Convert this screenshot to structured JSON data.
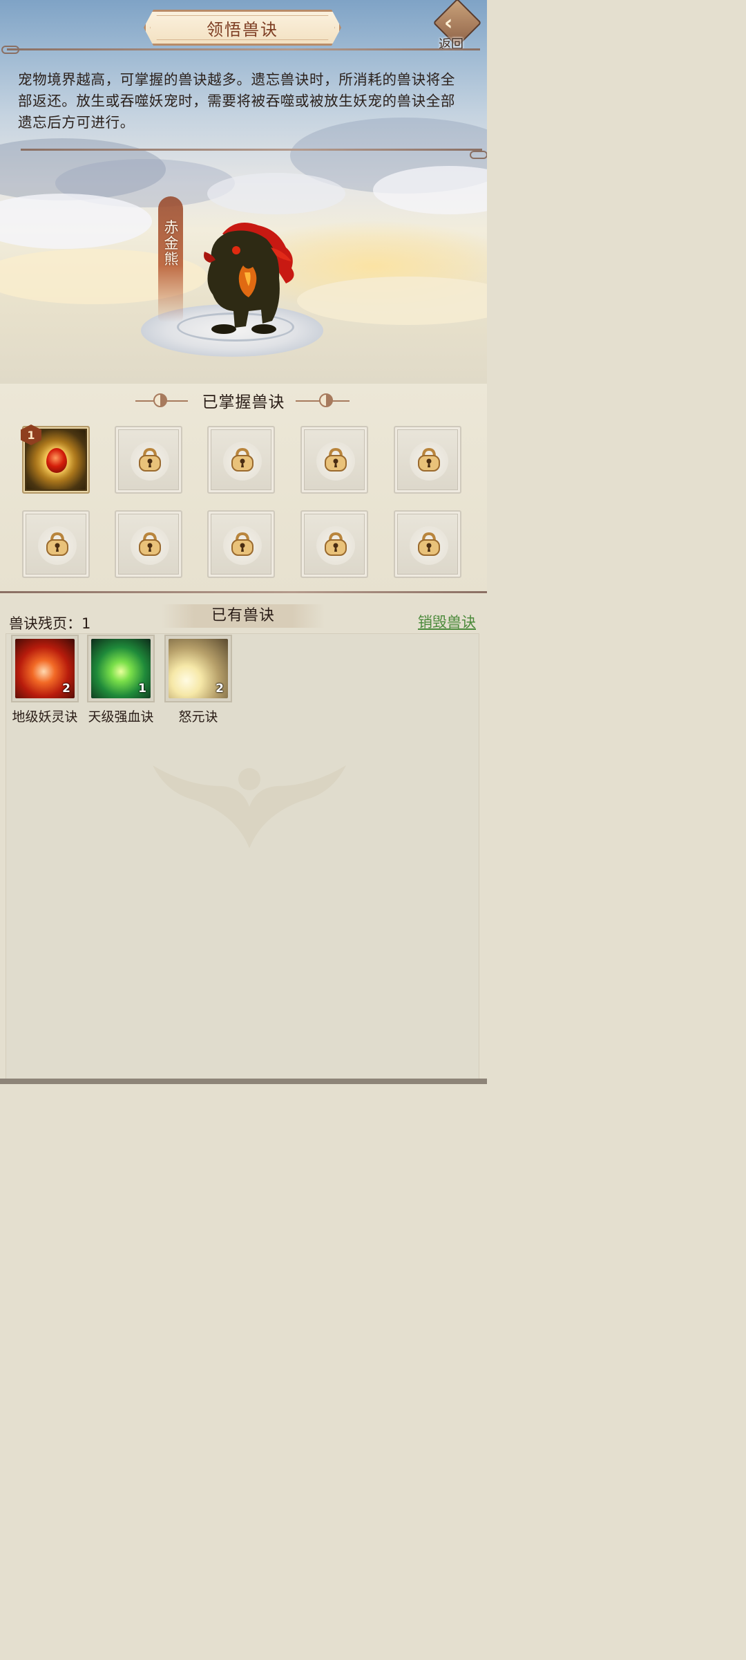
{
  "header": {
    "title": "领悟兽诀",
    "back_label": "返回"
  },
  "description": "宠物境界越高，可掌握的兽诀越多。遗忘兽诀时，所消耗的兽诀将全部返还。放生或吞噬妖宠时，需要将被吞噬或被放生妖宠的兽诀全部遗忘后方可进行。",
  "pet": {
    "name": "赤金熊"
  },
  "mastered": {
    "title": "已掌握兽诀",
    "slot1_level": "1"
  },
  "owned": {
    "title": "已有兽诀",
    "fragments_label": "兽诀残页：",
    "fragments_count": "1",
    "destroy_label": "销毁兽诀",
    "items": [
      {
        "name": "地级妖灵诀",
        "count": "2"
      },
      {
        "name": "天级强血诀",
        "count": "1"
      },
      {
        "name": "怒元诀",
        "count": "2"
      }
    ]
  },
  "colors": {
    "accent_text": "#7d3d22",
    "link_green": "#4b8a3b",
    "panel_bg": "#e4dfcf"
  },
  "icons": {
    "back": "back-arrow-icon",
    "lock": "lock-icon",
    "taiji": "taiji-icon"
  }
}
